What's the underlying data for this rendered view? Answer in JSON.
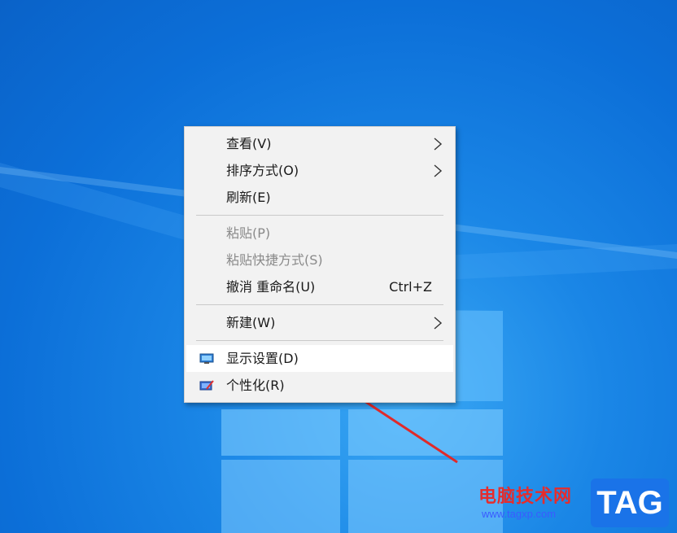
{
  "context_menu": {
    "items": [
      {
        "label": "查看(V)",
        "has_submenu": true,
        "enabled": true
      },
      {
        "label": "排序方式(O)",
        "has_submenu": true,
        "enabled": true
      },
      {
        "label": "刷新(E)",
        "has_submenu": false,
        "enabled": true
      },
      {
        "label": "粘贴(P)",
        "has_submenu": false,
        "enabled": false
      },
      {
        "label": "粘贴快捷方式(S)",
        "has_submenu": false,
        "enabled": false
      },
      {
        "label": "撤消 重命名(U)",
        "shortcut": "Ctrl+Z",
        "has_submenu": false,
        "enabled": true
      },
      {
        "label": "新建(W)",
        "has_submenu": true,
        "enabled": true
      },
      {
        "label": "显示设置(D)",
        "icon": "display-icon",
        "has_submenu": false,
        "enabled": true,
        "highlighted": true
      },
      {
        "label": "个性化(R)",
        "icon": "personalize-icon",
        "has_submenu": false,
        "enabled": true
      }
    ]
  },
  "watermark": {
    "site_name": "电脑技术网",
    "url": "www.tagxp.com",
    "logo_text": "TAG"
  },
  "colors": {
    "desktop_blue": "#0c6fd8",
    "menu_background": "#f2f2f2",
    "arrow_red": "#e02a2a",
    "watermark_red": "#e52d2d",
    "watermark_blue": "#1a73e8"
  }
}
